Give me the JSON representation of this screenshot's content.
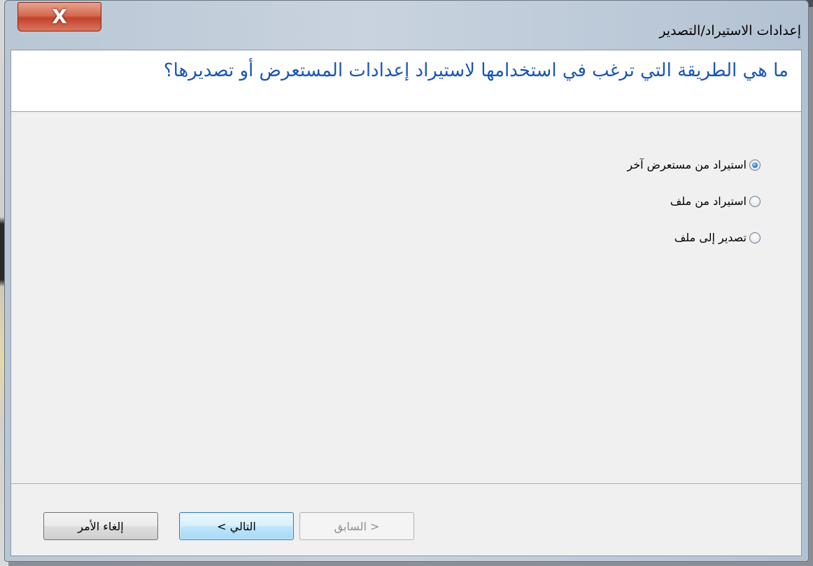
{
  "window": {
    "title": "إعدادات الاستيراد/التصدير",
    "close_glyph": "X"
  },
  "header": {
    "question": "ما هي الطريقة التي ترغب في استخدامها لاستيراد إعدادات المستعرض أو تصديرها؟"
  },
  "options": [
    {
      "label": "استيراد من مستعرض آخر",
      "checked": true
    },
    {
      "label": "استيراد من ملف",
      "checked": false
    },
    {
      "label": "تصدير إلى ملف",
      "checked": false
    }
  ],
  "buttons": {
    "back_label": "< السابق",
    "next_label": "التالي >",
    "cancel_label": "إلغاء الأمر"
  },
  "colors": {
    "heading": "#1a56b4",
    "close_button": "#c2422b",
    "default_button_border": "#3c7fb1"
  }
}
